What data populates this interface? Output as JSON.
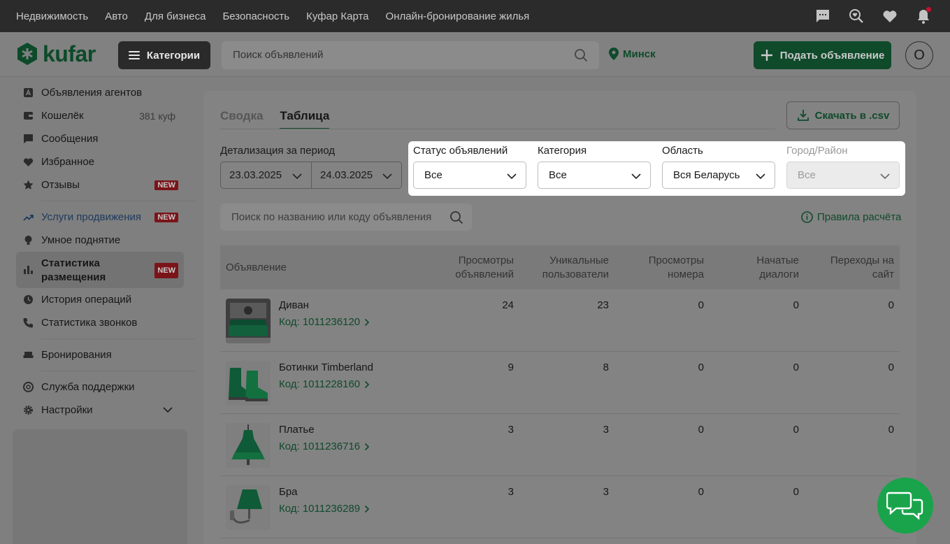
{
  "topbar": {
    "links": [
      "Недвижимость",
      "Авто",
      "Для бизнеса",
      "Безопасность",
      "Куфар Карта",
      "Онлайн-бронирование жилья"
    ],
    "icons": [
      "message-icon",
      "heart-search-icon",
      "heart-icon",
      "bell-icon"
    ]
  },
  "header": {
    "logo": "kufar",
    "categories_label": "Категории",
    "search_placeholder": "Поиск объявлений",
    "city": "Минск",
    "post_label": "Подать объявление",
    "avatar_letter": "О"
  },
  "sidebar": {
    "items": [
      {
        "label": "Объявления агентов",
        "icon": "agent-icon"
      },
      {
        "label": "Кошелёк",
        "icon": "wallet-icon",
        "right": "381 куф"
      },
      {
        "label": "Сообщения",
        "icon": "message-icon"
      },
      {
        "label": "Избранное",
        "icon": "heart-icon"
      },
      {
        "label": "Отзывы",
        "icon": "star-icon",
        "badge": "NEW"
      },
      {
        "label": "Услуги продвижения",
        "icon": "trend-icon",
        "badge": "NEW"
      },
      {
        "label": "Умное поднятие",
        "icon": "bulb-icon"
      },
      {
        "label": "Статистика размещения",
        "icon": "bars-icon",
        "badge": "NEW"
      },
      {
        "label": "История операций",
        "icon": "clock-icon"
      },
      {
        "label": "Статистика звонков",
        "icon": "phone-icon"
      },
      {
        "label": "Бронирования",
        "icon": "bed-icon"
      },
      {
        "label": "Служба поддержки",
        "icon": "support-icon"
      },
      {
        "label": "Настройки",
        "icon": "gear-icon"
      }
    ]
  },
  "tabs": [
    "Сводка",
    "Таблица"
  ],
  "active_tab": "Таблица",
  "csv_label": "Скачать в .csv",
  "period": {
    "label": "Детализация за период",
    "from": "23.03.2025",
    "to": "24.03.2025"
  },
  "filters": [
    {
      "label": "Статус объявлений",
      "value": "Все"
    },
    {
      "label": "Категория",
      "value": "Все"
    },
    {
      "label": "Область",
      "value": "Вся Беларусь"
    },
    {
      "label": "Город/Район",
      "value": "Все",
      "disabled": true
    }
  ],
  "table_search_placeholder": "Поиск по названию или коду объявления",
  "rules_label": "Правила расчёта",
  "table": {
    "headers": [
      "Объявление",
      "Просмотры объявлений",
      "Уникальные пользователи",
      "Просмотры номера",
      "Начатые диалоги",
      "Переходы на сайт"
    ],
    "rows": [
      {
        "name": "Диван",
        "code": "Код: 1011236120",
        "views": "24",
        "unique": "23",
        "phone": "0",
        "dialogs": "0",
        "site": "0"
      },
      {
        "name": "Ботинки Timberland",
        "code": "Код: 1011228160",
        "views": "9",
        "unique": "8",
        "phone": "0",
        "dialogs": "0",
        "site": "0"
      },
      {
        "name": "Платье",
        "code": "Код: 1011236716",
        "views": "3",
        "unique": "3",
        "phone": "0",
        "dialogs": "0",
        "site": "0"
      },
      {
        "name": "Бра",
        "code": "Код: 1011236289",
        "views": "3",
        "unique": "3",
        "phone": "0",
        "dialogs": "0",
        "site": ""
      }
    ]
  },
  "colors": {
    "brand_green": "#19a44b",
    "new_badge": "#c8102e",
    "overlay": "#7f7f7f"
  }
}
